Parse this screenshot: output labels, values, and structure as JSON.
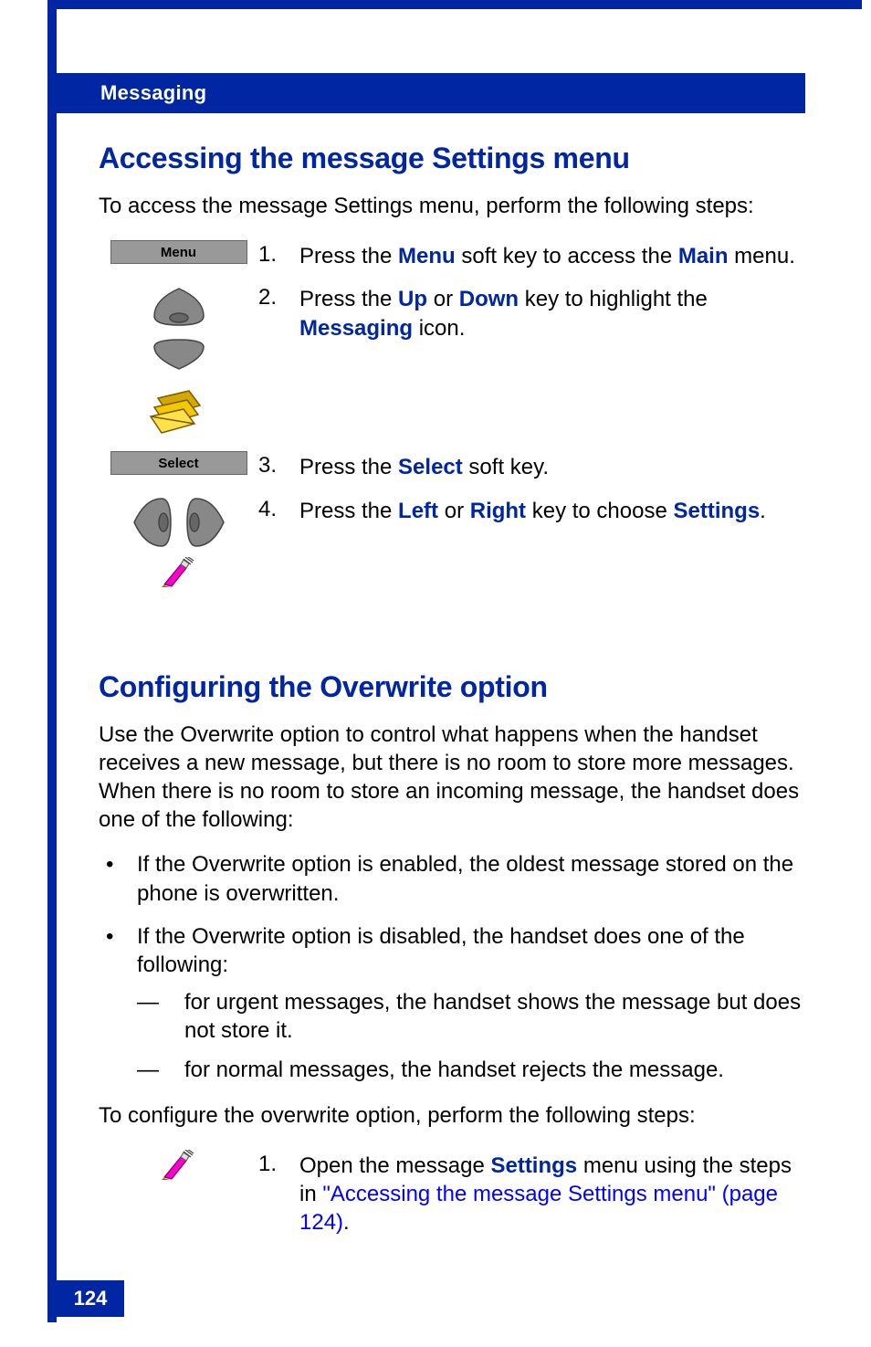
{
  "header": {
    "section": "Messaging"
  },
  "section1": {
    "title": "Accessing the message Settings menu",
    "intro": "To access the message Settings menu, perform the following steps:",
    "steps": [
      {
        "num": "1.",
        "soft_label": "Menu",
        "pre": "Press the ",
        "kw1": "Menu",
        "mid": " soft key to access the ",
        "kw2": "Main",
        "post": " menu."
      },
      {
        "num": "2.",
        "pre": "Press the ",
        "kw1": "Up",
        "mid": " or ",
        "kw2": "Down",
        "post1": " key to highlight the ",
        "kw3": "Messaging",
        "post2": " icon."
      },
      {
        "num": "3.",
        "soft_label": "Select",
        "pre": "Press the ",
        "kw1": "Select",
        "post": " soft key."
      },
      {
        "num": "4.",
        "pre": "Press the ",
        "kw1": "Left",
        "mid": " or ",
        "kw2": "Right",
        "post1": " key to choose ",
        "kw3": "Settings",
        "post2": "."
      }
    ]
  },
  "section2": {
    "title": "Configuring the Overwrite option",
    "para": "Use the Overwrite option to control what happens when the handset receives a new message, but there is no room to store more messages. When there is no room to store an incoming message, the handset does one of the following:",
    "b1": "If the Overwrite option is enabled, the oldest message stored on the phone is overwritten.",
    "b2": "If the Overwrite option is disabled, the handset does one of the following:",
    "d1": "for urgent messages, the handset shows the message but does not store it.",
    "d2": "for normal messages, the handset rejects the message.",
    "para2": "To configure the overwrite option, perform the following steps:",
    "step1": {
      "num": "1.",
      "pre": "Open the message ",
      "kw1": "Settings",
      "mid": " menu using the steps in ",
      "link": "\"Accessing the message Settings menu\" (page 124)",
      "post": "."
    }
  },
  "page_number": "124"
}
